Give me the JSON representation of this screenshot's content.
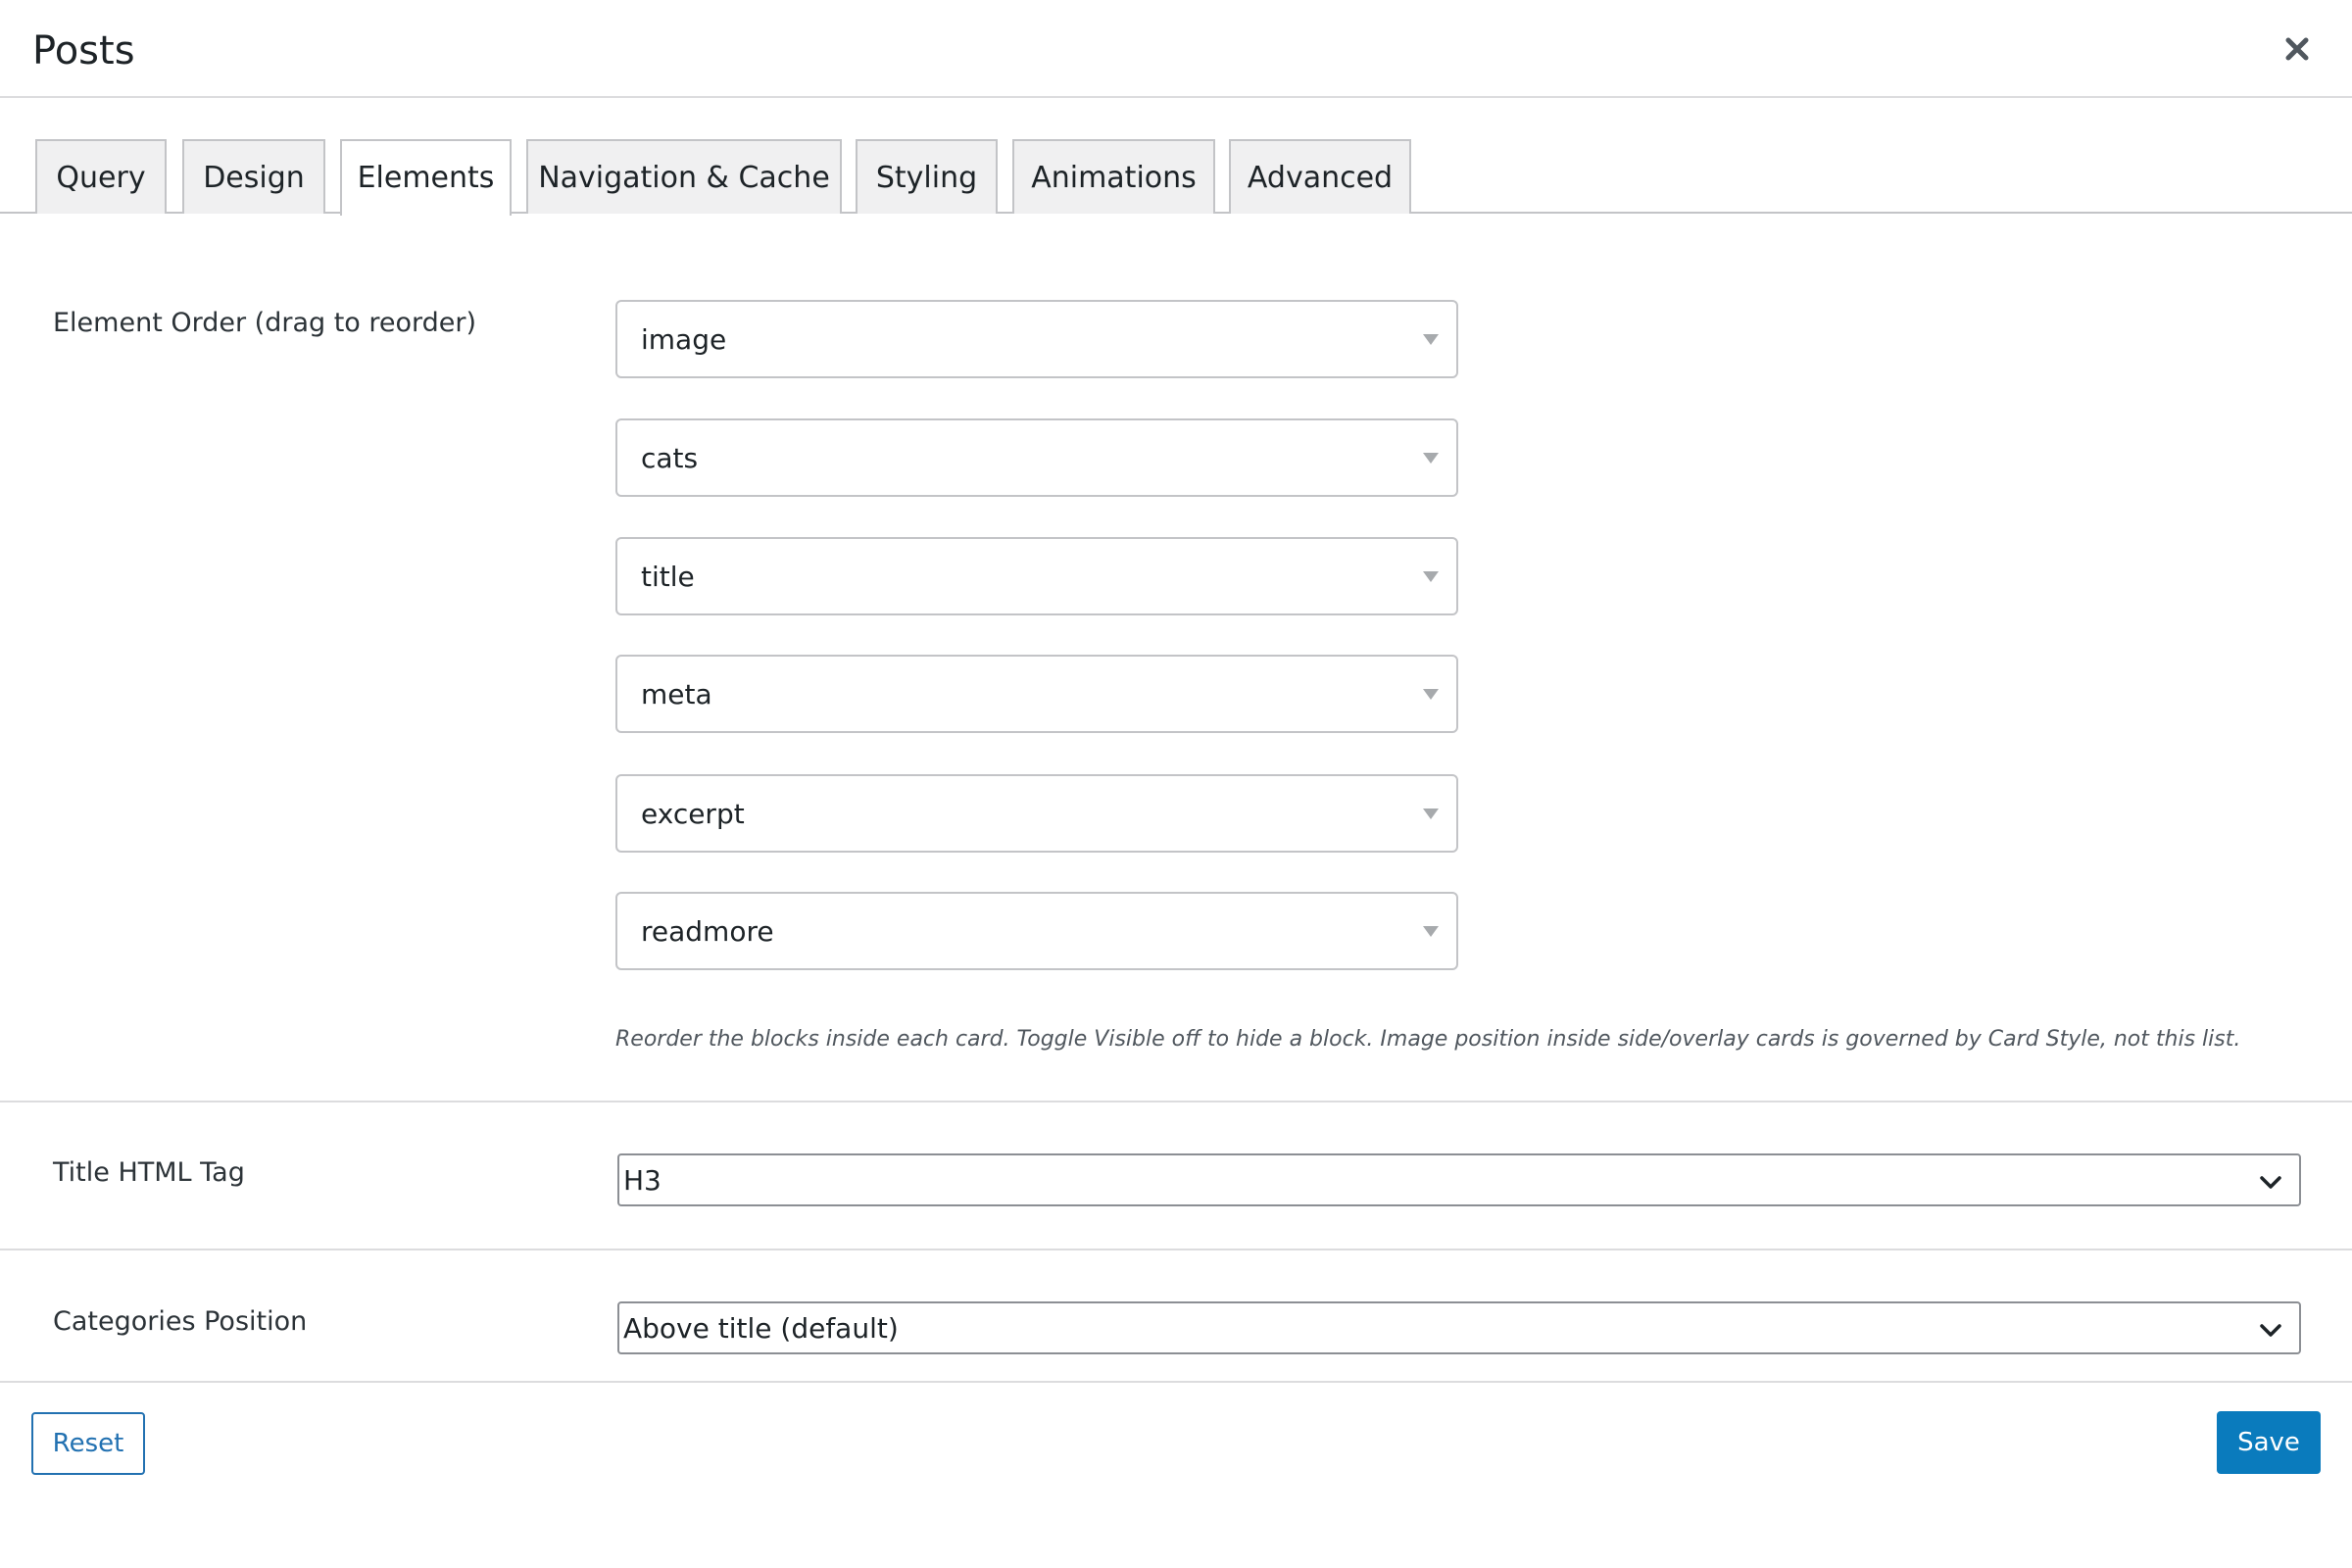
{
  "modal": {
    "title": "Posts",
    "close_icon": "close-icon"
  },
  "tabs": [
    {
      "label": "Query",
      "active": false
    },
    {
      "label": "Design",
      "active": false
    },
    {
      "label": "Elements",
      "active": true
    },
    {
      "label": "Navigation & Cache",
      "active": false
    },
    {
      "label": "Styling",
      "active": false
    },
    {
      "label": "Animations",
      "active": false
    },
    {
      "label": "Advanced",
      "active": false
    }
  ],
  "element_order": {
    "label": "Element Order (drag to reorder)",
    "items": [
      "image",
      "cats",
      "title",
      "meta",
      "excerpt",
      "readmore"
    ],
    "help": "Reorder the blocks inside each card. Toggle Visible off to hide a block. Image position inside side/overlay cards is governed by Card Style, not this list."
  },
  "title_tag": {
    "label": "Title HTML Tag",
    "value": "H3"
  },
  "categories_position": {
    "label": "Categories Position",
    "value": "Above title (default)"
  },
  "footer": {
    "reset_label": "Reset",
    "save_label": "Save"
  },
  "colors": {
    "accent": "#2271b1",
    "save_bg": "#0a7bbd",
    "border": "#c3c4c7"
  }
}
